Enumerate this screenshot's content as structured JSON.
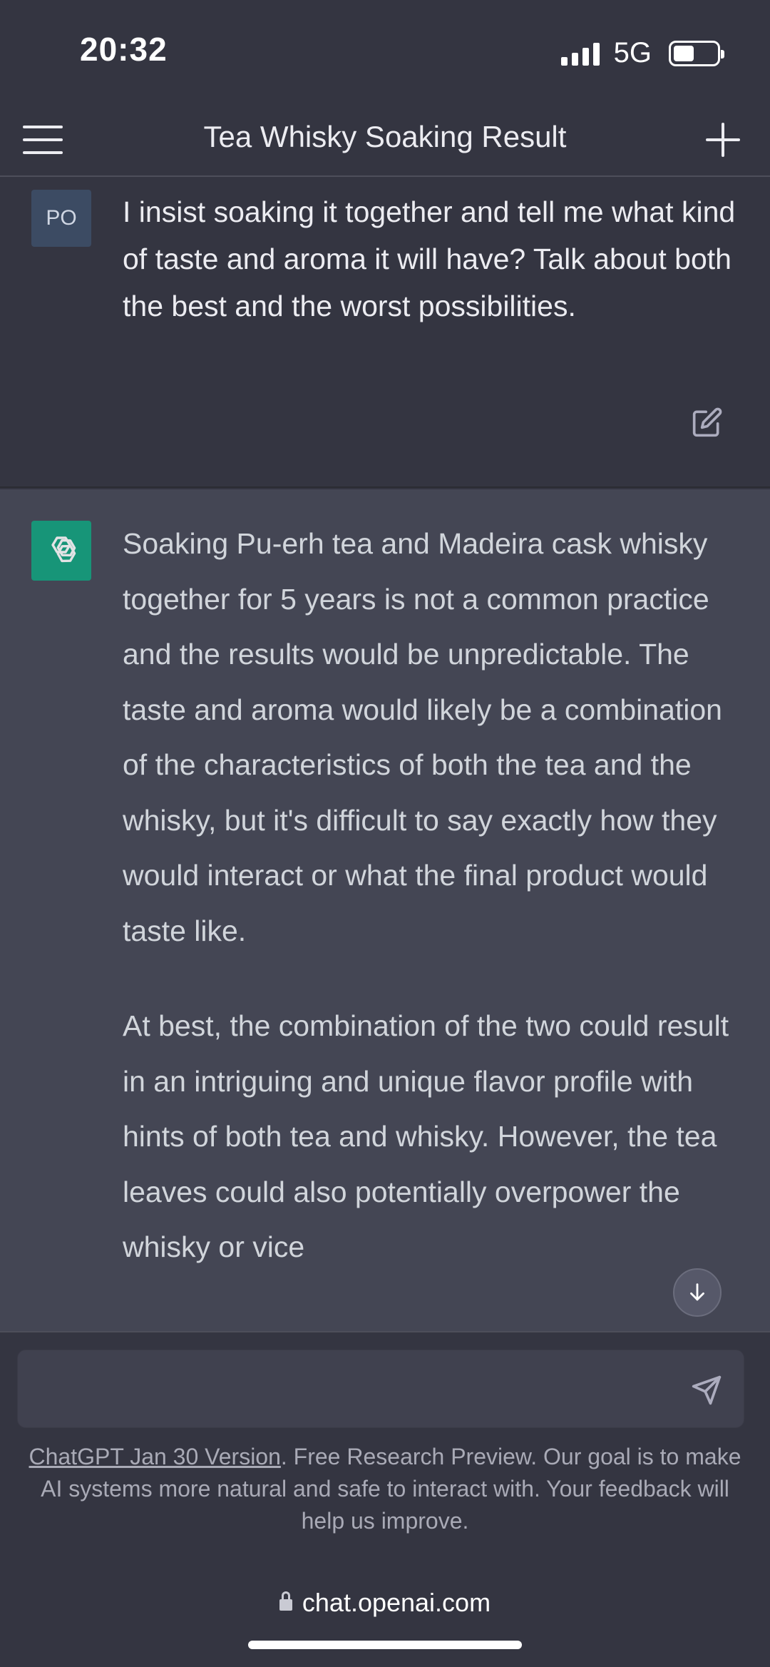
{
  "status_bar": {
    "time": "20:32",
    "network": "5G"
  },
  "header": {
    "title": "Tea Whisky Soaking Result"
  },
  "conversation": {
    "user_avatar_initials": "PO",
    "user_message": "I insist soaking it together and tell me what kind of taste and aroma it will have? Talk about both the best and the worst possibilities.",
    "assistant_paragraphs": [
      "Soaking Pu-erh tea and Madeira cask whisky together for 5 years is not a common practice and the results would be unpredictable. The taste and aroma would likely be a combination of the characteristics of both the tea and the whisky, but it's difficult to say exactly how they would interact or what the final product would taste like.",
      "At best, the combination of the two could result in an intriguing and unique flavor profile with hints of both tea and whisky. However, the tea leaves could also potentially overpower the whisky or vice"
    ]
  },
  "composer": {
    "input_value": "",
    "input_placeholder": ""
  },
  "footer": {
    "version_link": "ChatGPT Jan 30 Version",
    "note": ". Free Research Preview. Our goal is to make AI systems more natural and safe to interact with. Your feedback will help us improve."
  },
  "browser": {
    "url": "chat.openai.com"
  },
  "colors": {
    "background": "#343541",
    "assistant_background": "#444654",
    "brand_green": "#10a37f"
  },
  "icons": {
    "menu": "menu-icon",
    "new_chat": "plus-icon",
    "edit": "edit-icon",
    "assistant_logo": "openai-logo-icon",
    "scroll_down": "arrow-down-icon",
    "send": "send-icon",
    "lock": "lock-icon"
  }
}
